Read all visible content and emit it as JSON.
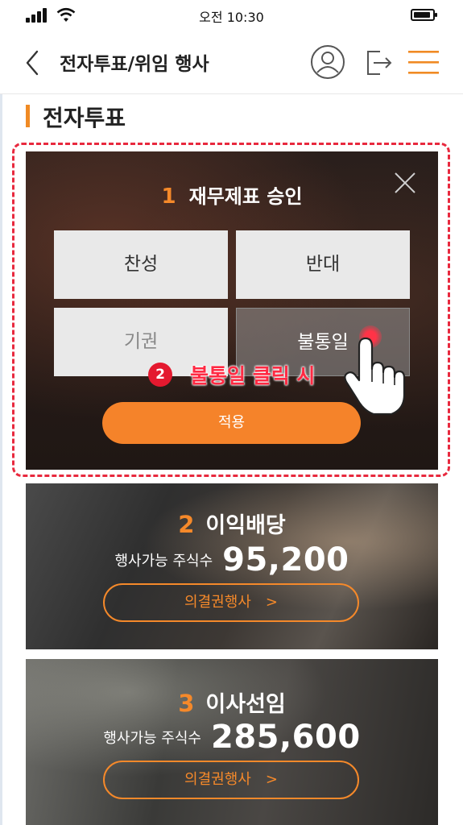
{
  "status_bar": {
    "time": "오전 10:30",
    "icons": [
      "signal-icon",
      "wifi-icon",
      "battery-icon"
    ]
  },
  "header": {
    "title": "전자투표/위임 행사",
    "icons": [
      "back-icon",
      "user-icon",
      "logout-icon",
      "menu-icon"
    ]
  },
  "section": {
    "title": "전자투표"
  },
  "modal": {
    "number": "1",
    "title": "재무제표 승인",
    "options": [
      {
        "label": "찬성",
        "state": "normal"
      },
      {
        "label": "반대",
        "state": "normal"
      },
      {
        "label": "기권",
        "state": "disabled"
      },
      {
        "label": "불통일",
        "state": "selected"
      }
    ],
    "apply_label": "적용"
  },
  "annotation": {
    "step": "2",
    "text": "불통일 클릭 시"
  },
  "cards": [
    {
      "number": "2",
      "title": "이익배당",
      "shares_label": "행사가능 주식수",
      "shares_value": "95,200",
      "button_label": "의결권행사",
      "chevron": ">"
    },
    {
      "number": "3",
      "title": "이사선임",
      "shares_label": "행사가능 주식수",
      "shares_value": "285,600",
      "button_label": "의결권행사",
      "chevron": ">"
    }
  ],
  "colors": {
    "accent": "#f5892a",
    "annotation_red": "#e4192f",
    "modal_dark": "#241a17"
  }
}
